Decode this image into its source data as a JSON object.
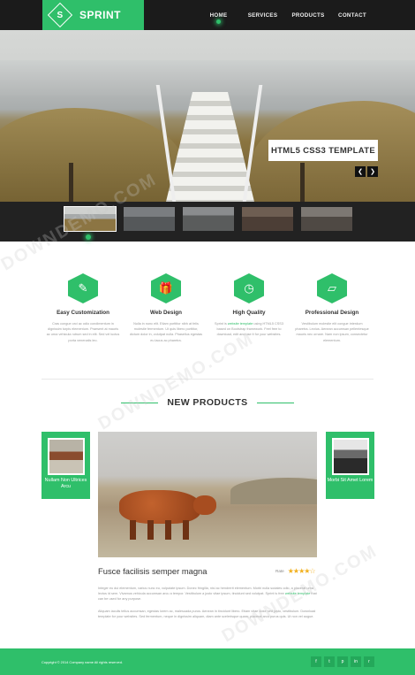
{
  "colors": {
    "accent": "#2fbf6a",
    "header_bg": "#1b1b1b",
    "footer_bg": "#2fbf6a"
  },
  "logo": {
    "mark": "S",
    "text": "SPRINT"
  },
  "nav": [
    {
      "label": "HOME",
      "active": true
    },
    {
      "label": "SERVICES",
      "active": false
    },
    {
      "label": "PRODUCTS",
      "active": false
    },
    {
      "label": "CONTACT",
      "active": false
    }
  ],
  "hero": {
    "caption": "HTML5 CSS3 TEMPLATE",
    "prev_icon": "chevron-left-icon",
    "next_icon": "chevron-right-icon"
  },
  "features": [
    {
      "title": "Easy Customization",
      "icon": "pencil-icon",
      "text": "Cras congue orci ac odio condimentum in dignissim turpis elementum. Praesent at mauris ac urna vehicula rutrum sed in elit. Sed vel luctus porta venenatis leo."
    },
    {
      "title": "Web Design",
      "icon": "gift-icon",
      "text": "Nulla in nunc elit. Etiam porttitor nibh at felis molestie fermentum. Ut quis libero porttitor, dictum dolor in, volutpat nulla. Phasellus egestas eu lacus ac pharetra."
    },
    {
      "title": "High Quality",
      "icon": "clock-icon",
      "text_before": "Sprint is ",
      "text_link": "website template",
      "text_after": " using HTML5 CSS3 based on Bootstrap framework. Feel free to download, edit and use it for your websites."
    },
    {
      "title": "Professional Design",
      "icon": "paint-roller-icon",
      "text": "Vestibulum molestie elit congue interdum pharetra. Lectus. Aenean accumsan pellentesque mauris nec ornare. Nam non ipsum, consectetur elementum."
    }
  ],
  "products": {
    "heading": "NEW PRODUCTS",
    "left_card": {
      "label": "Nullam Non Ultrices Arcu"
    },
    "right_card": {
      "label": "Morbi Sit Amet Lorem"
    },
    "main": {
      "title": "Fusce facilisis semper magna",
      "rating_label": "Rate",
      "stars": "★★★★☆",
      "rating": 4,
      "para1_before": "Integer eu dui elementum, varius nunc eu, vulputate ipsum. Donec fringilla, nisi ac hendrerit elementum. Morbi nulla sodales odio, a placerat urna lectus id sem. Vivamus vehicula accumsan arcu a tempor. Vestibulum a justo vitae ipsum, tincidunt sed volutpat. Sprint is free ",
      "para1_link": "website template",
      "para1_after": " that can be used for any purpose.",
      "para2": "Aliquam iaculis tellus accumsan, egestas lorem ac, malesuada purus. Aenean in tincidunt libero. Etiam vitae dolor sed justo, vestibulum. Download template for your websites. Sed fermentum, neque in dignissim aliquam, diam ante scelerisque quam, placerat arcu purus quis. Ut non vel augue."
    }
  },
  "footer": {
    "copyright": "Copyright © 2014 Company name All rights reserved.",
    "socials": [
      "facebook-icon",
      "twitter-icon",
      "pinterest-icon",
      "linkedin-icon",
      "rss-icon"
    ],
    "social_glyphs": [
      "f",
      "t",
      "p",
      "in",
      "r"
    ]
  },
  "watermark": "DOWNDEMO.COM"
}
